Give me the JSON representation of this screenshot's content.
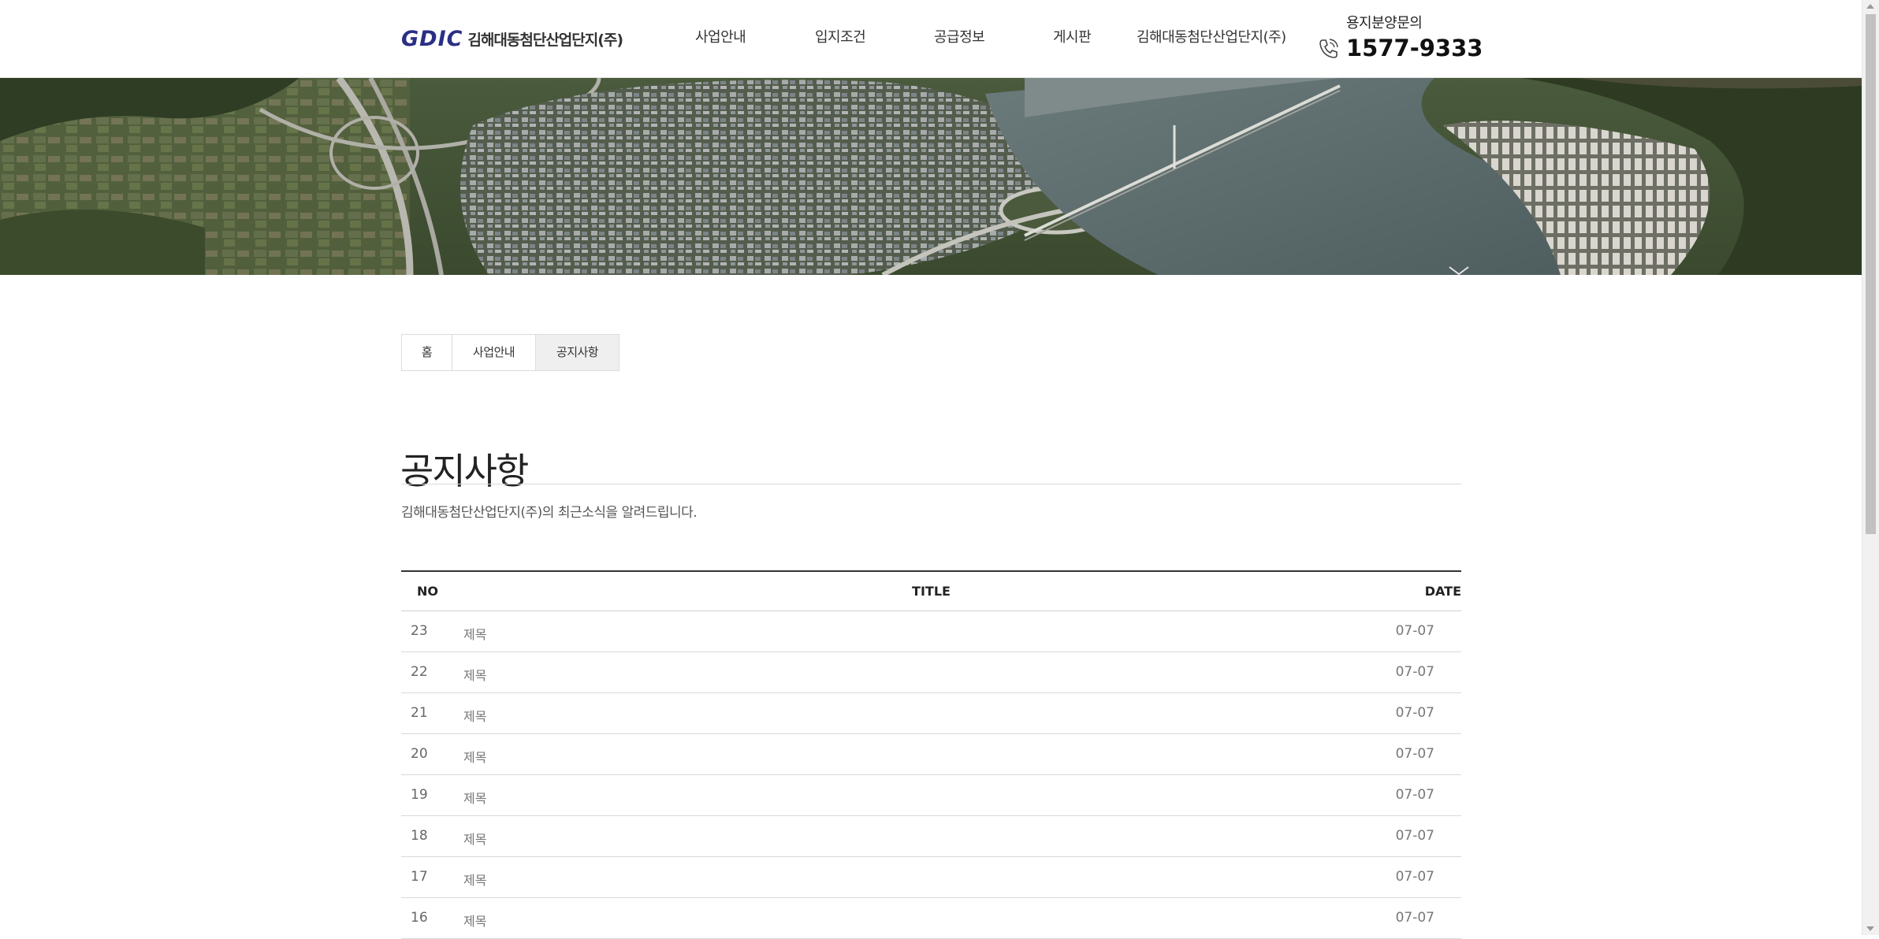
{
  "header": {
    "logo_mark": "GDIC",
    "logo_text": "김해대동첨단산업단지(주)",
    "nav": [
      {
        "label": "사업안내"
      },
      {
        "label": "입지조건"
      },
      {
        "label": "공급정보"
      },
      {
        "label": "게시판"
      },
      {
        "label": "김해대동첨단산업단지(주)"
      }
    ],
    "contact_label": "용지분양문의",
    "contact_phone": "1577-9333"
  },
  "breadcrumb": [
    "홈",
    "사업안내",
    "공지사항"
  ],
  "page": {
    "title": "공지사항",
    "description": "김해대동첨단산업단지(주)의 최근소식을 알려드립니다."
  },
  "board": {
    "columns": {
      "no": "NO",
      "title": "TITLE",
      "date": "DATE"
    },
    "rows": [
      {
        "no": "23",
        "title": "제목",
        "date": "07-07"
      },
      {
        "no": "22",
        "title": "제목",
        "date": "07-07"
      },
      {
        "no": "21",
        "title": "제목",
        "date": "07-07"
      },
      {
        "no": "20",
        "title": "제목",
        "date": "07-07"
      },
      {
        "no": "19",
        "title": "제목",
        "date": "07-07"
      },
      {
        "no": "18",
        "title": "제목",
        "date": "07-07"
      },
      {
        "no": "17",
        "title": "제목",
        "date": "07-07"
      },
      {
        "no": "16",
        "title": "제목",
        "date": "07-07"
      }
    ]
  },
  "colors": {
    "brand": "#2a2f86",
    "river": "#596a6a",
    "forest": "#34452a"
  }
}
